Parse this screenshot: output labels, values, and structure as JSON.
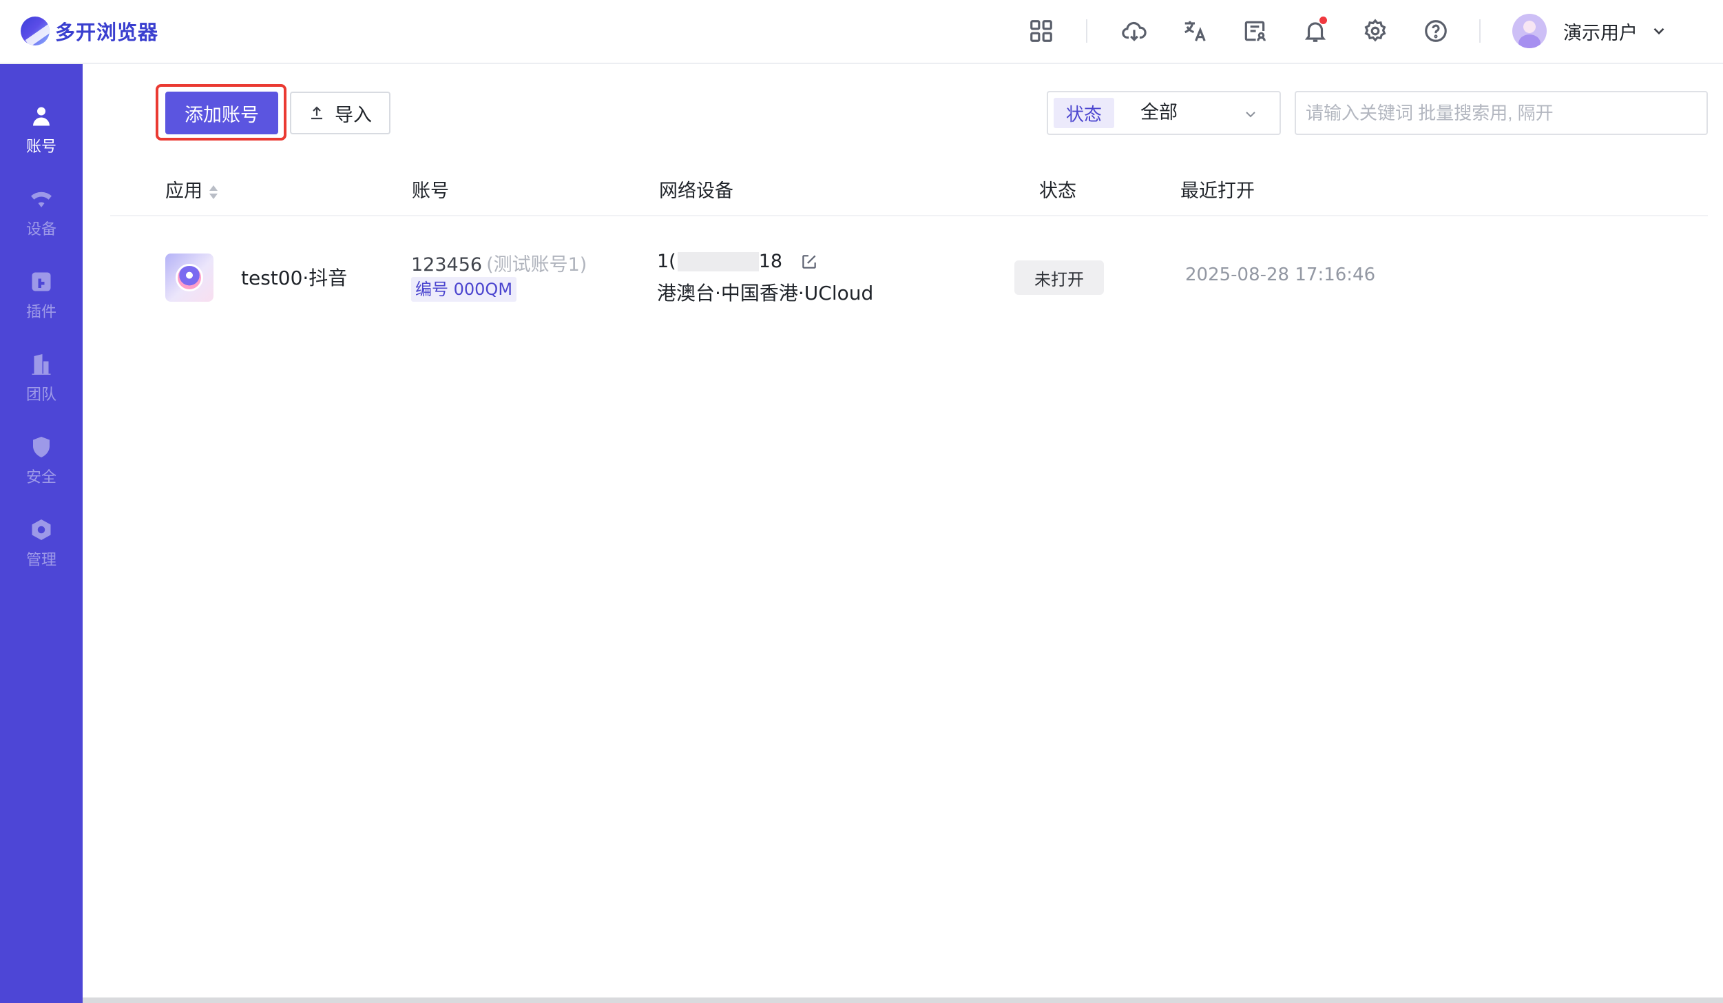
{
  "app": {
    "brand_name": "多开浏览器",
    "brand_color": "#3a3fcf",
    "accent": "#5b55e0"
  },
  "topbar": {
    "icons": [
      "apps-grid-icon",
      "cloud-download-icon",
      "translate-icon",
      "contact-card-icon",
      "bell-icon",
      "gear-icon",
      "help-icon"
    ],
    "user_name": "演示用户"
  },
  "sidebar": {
    "color": "#4d46d6",
    "items": [
      {
        "label": "账号",
        "icon": "user-icon",
        "active": true
      },
      {
        "label": "设备",
        "icon": "wifi-icon",
        "active": false
      },
      {
        "label": "插件",
        "icon": "plugin-icon",
        "active": false
      },
      {
        "label": "团队",
        "icon": "building-icon",
        "active": false
      },
      {
        "label": "安全",
        "icon": "shield-icon",
        "active": false
      },
      {
        "label": "管理",
        "icon": "hexagon-icon",
        "active": false
      }
    ]
  },
  "toolbar": {
    "add_label": "添加账号",
    "import_label": "导入",
    "status_filter": {
      "tag": "状态",
      "value": "全部"
    },
    "search_placeholder": "请输入关键词 批量搜索用, 隔开"
  },
  "table": {
    "columns": [
      "应用",
      "账号",
      "网络设备",
      "状态",
      "最近打开"
    ],
    "rows": [
      {
        "app_name": "test00·抖音",
        "account_id": "123456",
        "account_remark": "(测试账号1)",
        "account_code": "编号 000QM",
        "ip_prefix": "1(",
        "ip_suffix": "18",
        "location": "港澳台·中国香港·UCloud",
        "status": "未打开",
        "last_opened": "2025-08-28 17:16:46"
      }
    ]
  }
}
